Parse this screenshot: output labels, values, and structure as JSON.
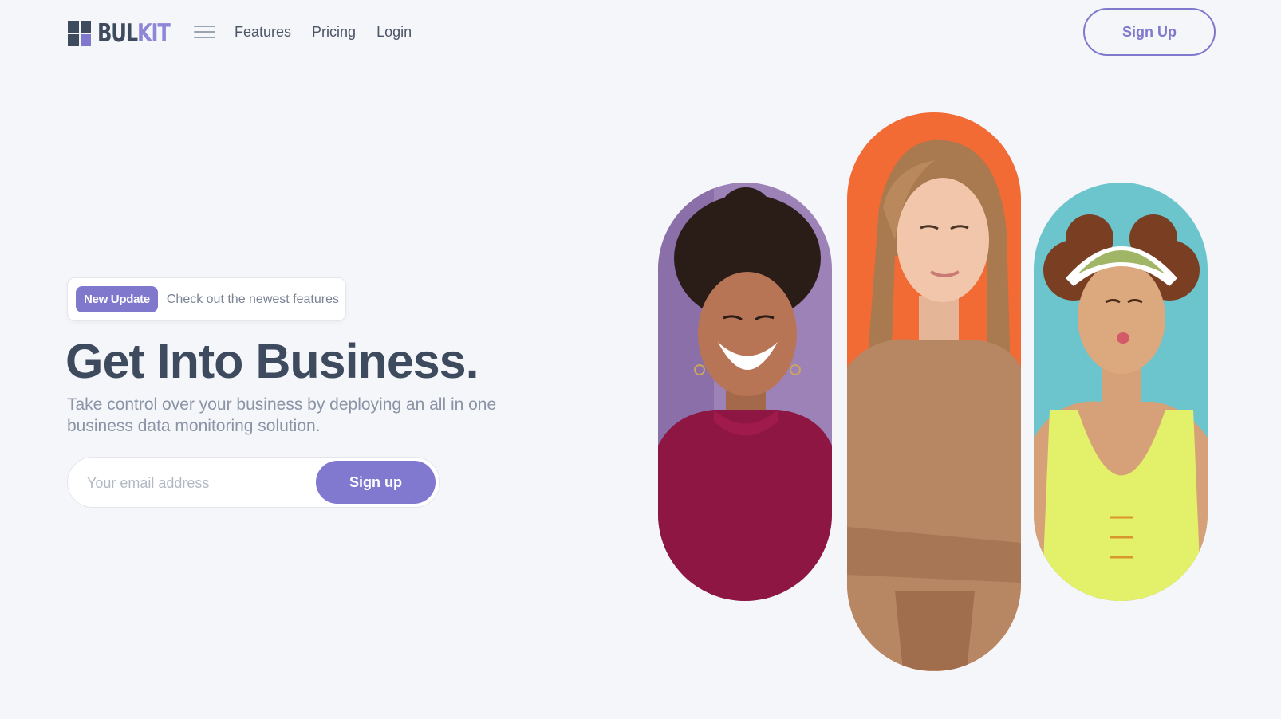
{
  "brand": {
    "name_part1": "BUL",
    "name_part2": "KIT",
    "primary_color": "#7f78cc",
    "dark_color": "#3e4b5e"
  },
  "nav": {
    "menu_icon": "hamburger-menu-icon",
    "links": [
      {
        "label": "Features"
      },
      {
        "label": "Pricing"
      },
      {
        "label": "Login"
      }
    ],
    "signup_label": "Sign Up"
  },
  "hero": {
    "badge_label": "New Update",
    "badge_text": "Check out the newest features",
    "title": "Get Into Business.",
    "subtitle": "Take control over your business by deploying an all in one business data monitoring solution.",
    "email_placeholder": "Your email address",
    "email_value": "",
    "cta_label": "Sign up"
  },
  "gallery": {
    "images": [
      {
        "subject": "smiling woman in red turtleneck",
        "bg_color": "#9d82b8"
      },
      {
        "subject": "woman in tan knit sweater",
        "bg_color": "#f26a34"
      },
      {
        "subject": "woman in visor and yellow swimsuit",
        "bg_color": "#6cc4cc"
      }
    ]
  }
}
